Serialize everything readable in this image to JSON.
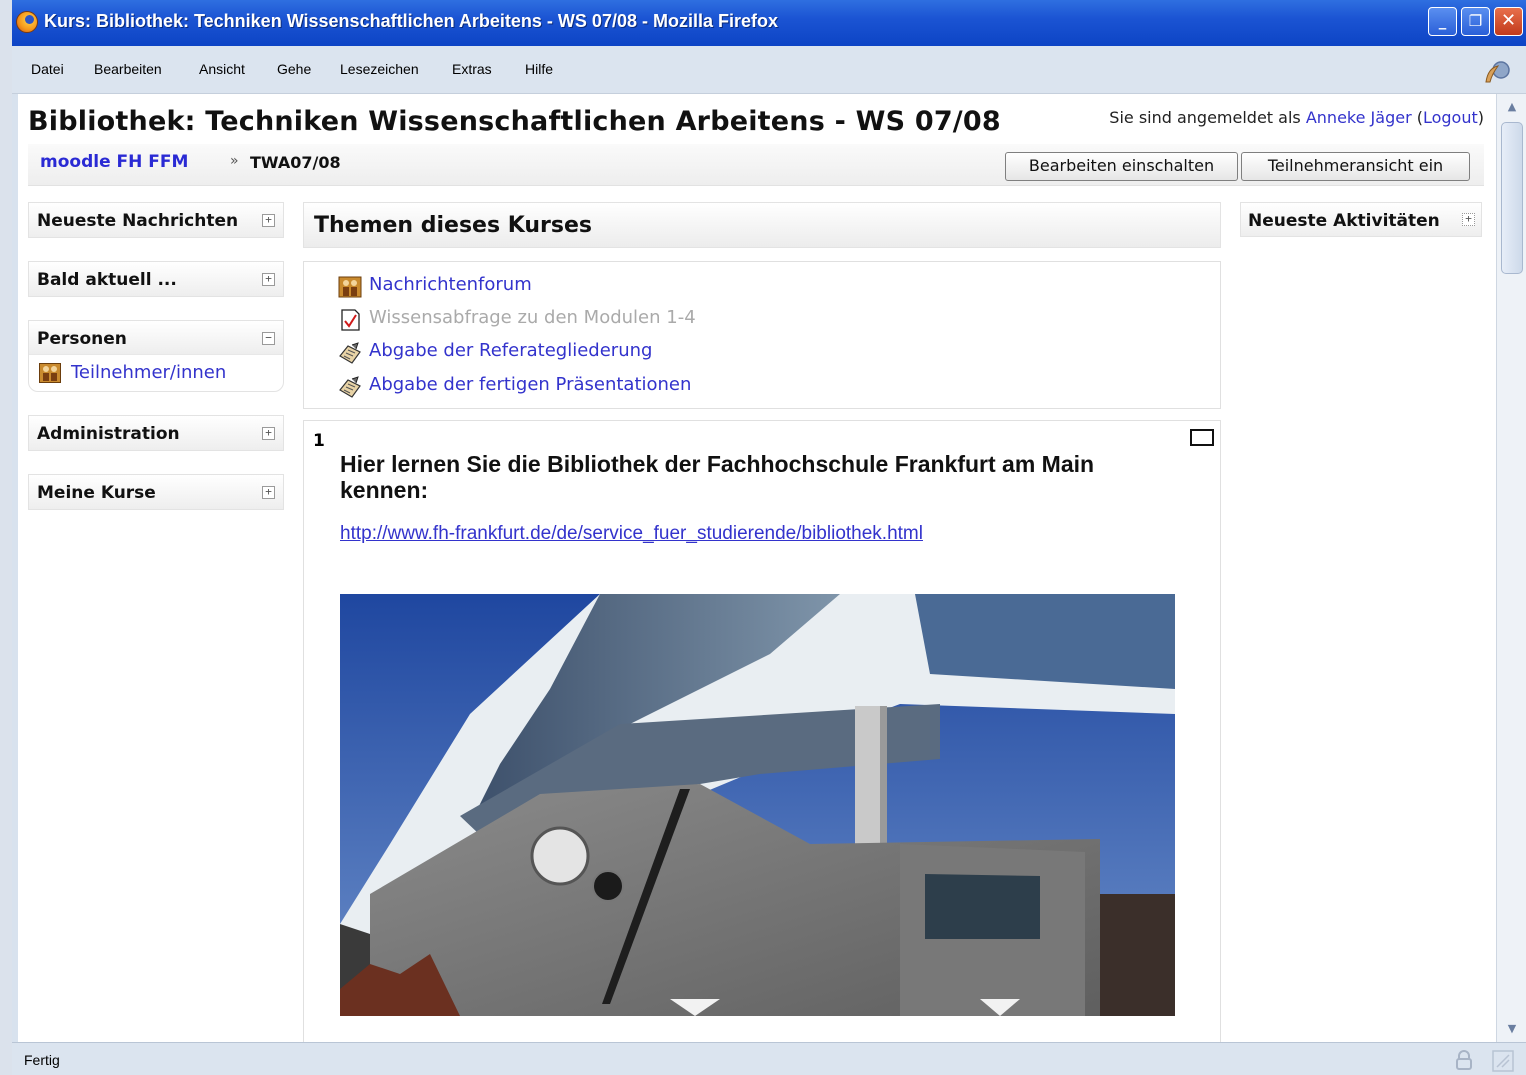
{
  "window": {
    "title": "Kurs: Bibliothek: Techniken Wissenschaftlichen Arbeitens - WS 07/08 - Mozilla Firefox"
  },
  "menubar": {
    "items": [
      {
        "label": "Datei"
      },
      {
        "label": "Bearbeiten"
      },
      {
        "label": "Ansicht"
      },
      {
        "label": "Gehe"
      },
      {
        "label": "Lesezeichen"
      },
      {
        "label": "Extras"
      },
      {
        "label": "Hilfe"
      }
    ]
  },
  "page": {
    "title": "Bibliothek: Techniken Wissenschaftlichen Arbeitens - WS 07/08",
    "login": {
      "prefix": "Sie sind angemeldet als",
      "user": "Anneke Jäger",
      "logout": "Logout"
    }
  },
  "navbar": {
    "home": "moodle FH FFM",
    "separator": "»",
    "current": "TWA07/08",
    "edit_button": "Bearbeiten einschalten",
    "view_button": "Teilnehmeransicht ein"
  },
  "left_blocks": {
    "news": {
      "title": "Neueste Nachrichten",
      "toggle": "+"
    },
    "upcoming": {
      "title": "Bald aktuell ...",
      "toggle": "+"
    },
    "people": {
      "title": "Personen",
      "toggle": "−",
      "link": "Teilnehmer/innen"
    },
    "admin": {
      "title": "Administration",
      "toggle": "+"
    },
    "courses": {
      "title": "Meine Kurse",
      "toggle": "+"
    }
  },
  "main": {
    "topics_heading": "Themen dieses Kurses",
    "section0": {
      "activities": [
        {
          "label": "Nachrichtenforum",
          "icon": "forum-icon"
        },
        {
          "label": "Wissensabfrage zu den Modulen 1-4",
          "icon": "quiz-icon"
        },
        {
          "label": "Abgabe der Referategliederung",
          "icon": "assignment-icon"
        },
        {
          "label": "Abgabe der fertigen Präsentationen",
          "icon": "assignment-icon"
        }
      ]
    },
    "section1": {
      "number": "1",
      "heading": "Hier lernen Sie die Bibliothek der Fachhochschule Frankfurt am Main kennen:",
      "link": "http://www.fh-frankfurt.de/de/service_fuer_studierende/bibliothek.html"
    }
  },
  "right_block": {
    "title": "Neueste Aktivitäten",
    "toggle": "+"
  },
  "statusbar": {
    "text": "Fertig"
  },
  "colors": {
    "titlebar": "#1b54d3",
    "link": "#3333cc",
    "dim": "#aaaaaa"
  }
}
